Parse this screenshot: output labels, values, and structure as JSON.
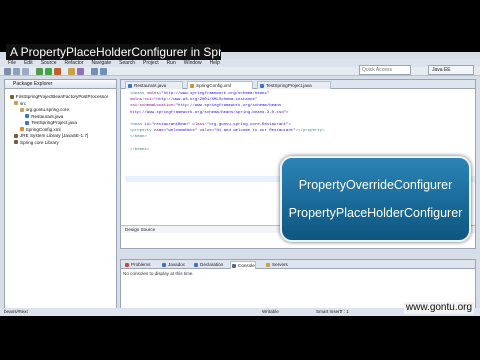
{
  "video": {
    "title": "A PropertyPlaceHolderConfigurer in Spring",
    "watermark": "www.gontu.org"
  },
  "ide": {
    "menu": [
      "File",
      "Edit",
      "Source",
      "Refactor",
      "Navigate",
      "Search",
      "Project",
      "Run",
      "Window",
      "Help"
    ],
    "search_placeholder": "Quick Access",
    "perspective_label": "Java EE",
    "package_explorer": {
      "tab_label": "Package Explorer",
      "tree": [
        {
          "label": "FirstSpringProjectBeanFactoryPostProcessor",
          "color": "#7a5c2e"
        },
        {
          "label": "src",
          "color": "#c9a24a"
        },
        {
          "label": "org.gontu.spring.core",
          "color": "#c9a24a"
        },
        {
          "label": "Restaurant.java",
          "color": "#3b74c8"
        },
        {
          "label": "TestSpringProject.java",
          "color": "#3b74c8"
        },
        {
          "label": "SpringConfig.xml",
          "color": "#e08a2a"
        },
        {
          "label": "JRE System Library [JavaSE-1.7]",
          "color": "#7a5c2e"
        },
        {
          "label": "Spring core Library",
          "color": "#7a5c2e"
        }
      ]
    },
    "editor": {
      "tabs": [
        {
          "label": "Restaurant.java",
          "active": false
        },
        {
          "label": "SpringConfig.xml",
          "active": true
        },
        {
          "label": "TestSpringProject.java",
          "active": false
        }
      ],
      "code": [
        [
          {
            "t": "<beans ",
            "c": "c-tag"
          },
          {
            "t": "xmlns=",
            "c": "c-attr"
          },
          {
            "t": "\"http://www.springframework.org/schema/beans\"",
            "c": "c-val"
          }
        ],
        [
          {
            "t": "    xmlns:xsi=",
            "c": "c-attr"
          },
          {
            "t": "\"http://www.w3.org/2001/XMLSchema-instance\"",
            "c": "c-val"
          }
        ],
        [
          {
            "t": "    xsi:schemaLocation=",
            "c": "c-attr"
          },
          {
            "t": "\"http://www.springframework.org/schema/beans",
            "c": "c-val"
          }
        ],
        [
          {
            "t": "http://www.springframework.org/schema/beans/spring-beans-3.0.xsd\">",
            "c": "c-val"
          }
        ],
        [
          {
            "t": "",
            "c": "c-txt"
          }
        ],
        [
          {
            "t": "    <bean ",
            "c": "c-tag"
          },
          {
            "t": "id=",
            "c": "c-attr"
          },
          {
            "t": "\"restaurantBean\" ",
            "c": "c-val"
          },
          {
            "t": "class=",
            "c": "c-attr"
          },
          {
            "t": "\"org.gontu.spring.core.Restaurant\">",
            "c": "c-val"
          }
        ],
        [
          {
            "t": "        <property ",
            "c": "c-tag"
          },
          {
            "t": "name=",
            "c": "c-attr"
          },
          {
            "t": "\"welcomeNote\" ",
            "c": "c-val"
          },
          {
            "t": "value=",
            "c": "c-attr"
          },
          {
            "t": "\"Hi and welcome to our Restaurant\"",
            "c": "c-val"
          },
          {
            "t": "></property>",
            "c": "c-tag"
          }
        ],
        [
          {
            "t": "    </bean>",
            "c": "c-tag"
          }
        ],
        [
          {
            "t": "",
            "c": "c-txt"
          }
        ],
        [
          {
            "t": "</beans>",
            "c": "c-tag"
          }
        ]
      ],
      "bottom_tabs": "Design  Source"
    },
    "console": {
      "tabs": [
        {
          "label": "Problems",
          "color": "#c94a3a",
          "active": false
        },
        {
          "label": "Javadoc",
          "color": "#3b74c8",
          "active": false
        },
        {
          "label": "Declaration",
          "color": "#3b74c8",
          "active": false
        },
        {
          "label": "Console",
          "color": "#5a6b80",
          "active": true
        },
        {
          "label": "Servers",
          "color": "#c9a24a",
          "active": false
        }
      ],
      "message": "No consoles to display at this time."
    },
    "status": {
      "left": "beans/#text",
      "mode": "Writable",
      "insert": "Smart Insert",
      "position": "7 : 1"
    }
  },
  "overlay": {
    "line1": "PropertyOverrideConfigurer",
    "line2": "PropertyPlaceHolderConfigurer"
  }
}
